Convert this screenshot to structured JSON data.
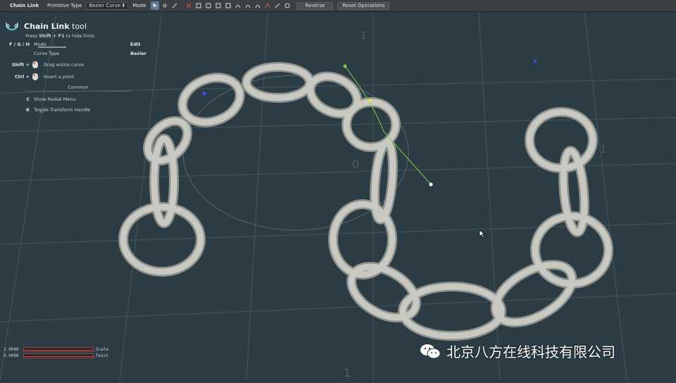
{
  "toolbar": {
    "tool_name": "Chain Link",
    "primitive_type_label": "Primitive Type",
    "primitive_type_value": "Bezier Curve",
    "mode_label": "Mode",
    "reverse_label": "Reverse",
    "reset_label": "Reset Operations",
    "icons": [
      "select-arrow-icon",
      "move-point-icon",
      "scale-icon",
      "delete-point-icon",
      "align-icon",
      "align-icon",
      "align-icon",
      "align-icon",
      "curve-icon",
      "curve-icon",
      "curve-icon",
      "curve-icon",
      "line-icon",
      "circle-icon"
    ]
  },
  "hints": {
    "title_bold": "Chain Link",
    "title_rest": " tool",
    "subtitle_pre": "Press ",
    "subtitle_key": "Shift + F1",
    "subtitle_post": " to hide hints",
    "rows": [
      {
        "key": "F / G / H",
        "desc": "Mode",
        "value": "Edit"
      },
      {
        "key": "",
        "desc": "Curve Type",
        "value": "Bezier"
      },
      {
        "key": "Shift +",
        "desc": "Drag entire curve",
        "value": ""
      },
      {
        "key": "Ctrl +",
        "desc": "Insert a point",
        "value": ""
      }
    ],
    "common_label": "Common",
    "common_rows": [
      {
        "key": "C",
        "desc": "Show Radial Menu"
      },
      {
        "key": "K",
        "desc": "Toggle Transform Handle"
      }
    ]
  },
  "sliders": [
    {
      "value": "1.0000",
      "label": "Scale",
      "fill": 1.0
    },
    {
      "value": "0.0000",
      "label": "Twist",
      "fill": 1.0
    }
  ],
  "grid_numbers": [
    "1",
    "0",
    "1",
    "1"
  ],
  "watermark": {
    "text": "北京八方在线科技有限公司",
    "icon": "wechat-icon"
  },
  "colors": {
    "background": "#2b3c44",
    "chain": "#c9c9c4",
    "guide": "#7fd04a",
    "axis_blue": "#3a56e8"
  }
}
